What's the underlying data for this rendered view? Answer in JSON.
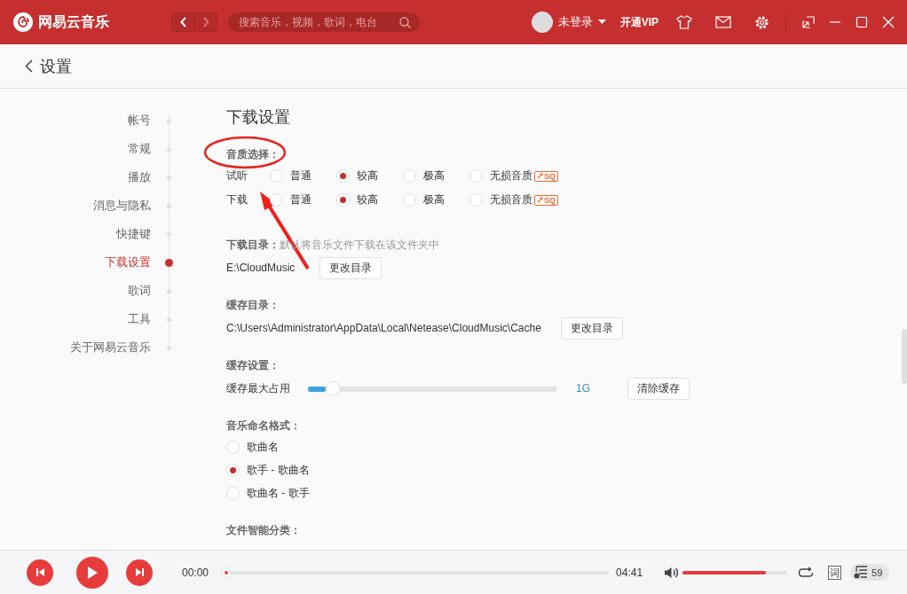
{
  "titlebar": {
    "app_name": "网易云音乐",
    "search": {
      "placeholder": "搜索音乐，视频，歌词，电台"
    },
    "user": "未登录",
    "vip": "开通VIP"
  },
  "page_header": {
    "title": "设置"
  },
  "nav": {
    "items": [
      {
        "label": "帐号",
        "selected": false
      },
      {
        "label": "常规",
        "selected": false
      },
      {
        "label": "播放",
        "selected": false
      },
      {
        "label": "消息与隐私",
        "selected": false
      },
      {
        "label": "快捷键",
        "selected": false
      },
      {
        "label": "下载设置",
        "selected": true
      },
      {
        "label": "歌词",
        "selected": false
      },
      {
        "label": "工具",
        "selected": false
      },
      {
        "label": "关于网易云音乐",
        "selected": false
      }
    ]
  },
  "section_title": "下载设置",
  "quality": {
    "label": "音质选择：",
    "rows": [
      {
        "label": "试听",
        "options": [
          {
            "label": "普通",
            "selected": false
          },
          {
            "label": "较高",
            "selected": true
          },
          {
            "label": "极高",
            "selected": false
          },
          {
            "label": "无损音质",
            "selected": false,
            "badge": "SQ"
          }
        ]
      },
      {
        "label": "下载",
        "options": [
          {
            "label": "普通",
            "selected": false
          },
          {
            "label": "较高",
            "selected": true
          },
          {
            "label": "极高",
            "selected": false
          },
          {
            "label": "无损音质",
            "selected": false,
            "badge": "SQ"
          }
        ]
      }
    ]
  },
  "download_dir": {
    "label": "下载目录：",
    "hint": "默认将音乐文件下载在该文件夹中",
    "path": "E:\\CloudMusic",
    "button": "更改目录"
  },
  "cache_dir": {
    "label": "缓存目录：",
    "path": "C:\\Users\\Administrator\\AppData\\Local\\Netease\\CloudMusic\\Cache",
    "button": "更改目录"
  },
  "cache_settings": {
    "label": "缓存设置：",
    "slider_label": "缓存最大占用",
    "level": 0.08,
    "reading": "1G",
    "button": "清除缓存"
  },
  "naming": {
    "label": "音乐命名格式：",
    "options": [
      {
        "label": "歌曲名",
        "selected": false
      },
      {
        "label": "歌手 - 歌曲名",
        "selected": true
      },
      {
        "label": "歌曲名 - 歌手",
        "selected": false
      }
    ]
  },
  "smart_sort": {
    "label": "文件智能分类："
  },
  "player": {
    "current_time": "00:00",
    "total_time": "04:41",
    "progress": {
      "level": 0.0
    },
    "volume": {
      "level": 0.8
    },
    "lyrics_button": "词",
    "playlist_count": "59"
  }
}
